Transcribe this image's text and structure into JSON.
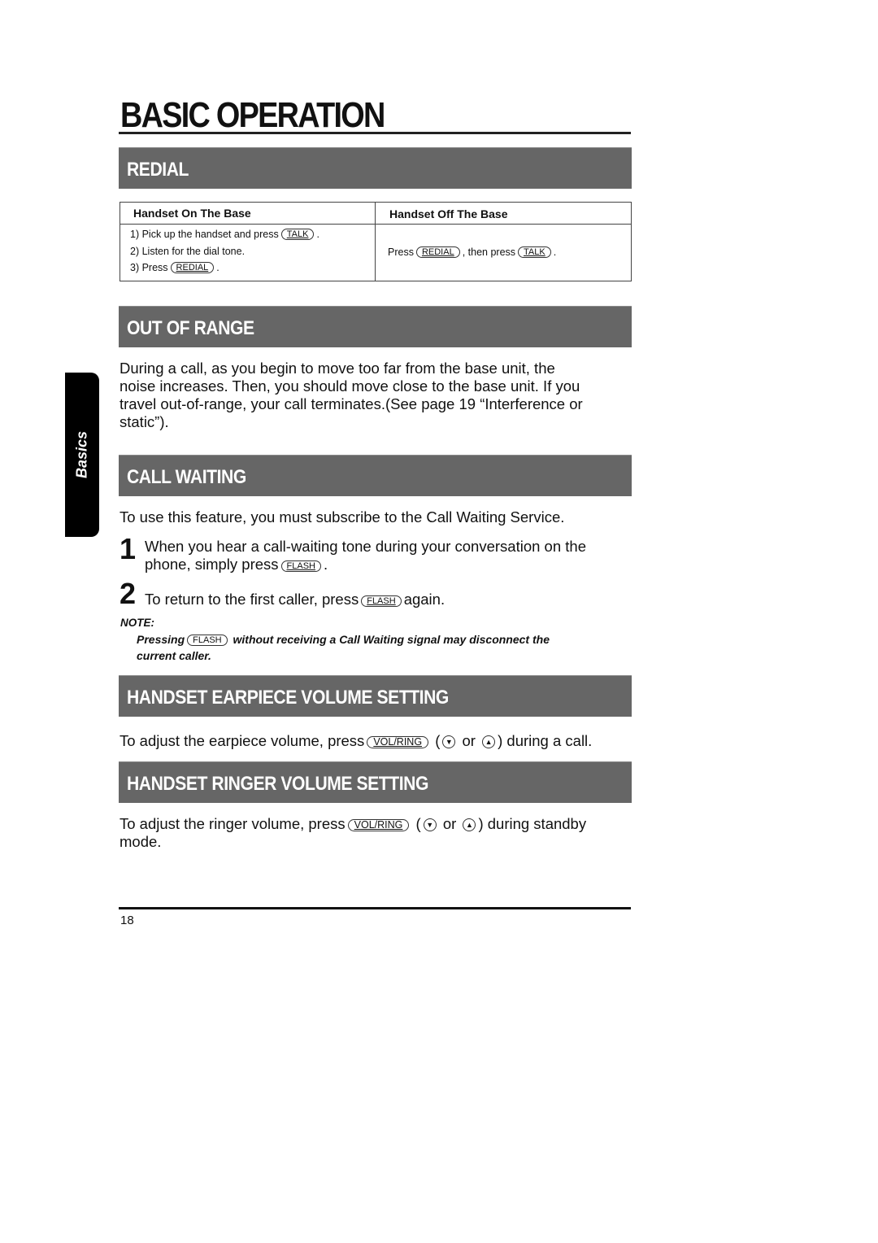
{
  "page": {
    "title": "BASIC OPERATION",
    "side_tab": "Basics",
    "page_number": "18"
  },
  "redial": {
    "heading": "REDIAL",
    "table": {
      "columns": [
        "Handset On The Base",
        "Handset Off The Base"
      ],
      "on_base_steps": [
        {
          "prefix": "1) Pick up the handset and press",
          "key": "TALK",
          "suffix": "."
        },
        {
          "prefix": "2) Listen for the dial tone.",
          "key": null,
          "suffix": ""
        },
        {
          "prefix": "3) Press",
          "key": "REDIAL",
          "suffix": "."
        }
      ],
      "off_base": {
        "prefix": "Press",
        "key1": "REDIAL",
        "middle": ", then press",
        "key2": "TALK",
        "suffix": "."
      }
    }
  },
  "out_of_range": {
    "heading": "OUT OF RANGE",
    "lines": [
      "During a call, as you begin to move too far from the base unit, the",
      "noise increases. Then, you should move close to the base unit. If you",
      "travel out-of-range, your call terminates.(See page 19 “Interference or",
      "static”)."
    ]
  },
  "call_waiting": {
    "heading": "CALL WAITING",
    "intro": "To use this feature, you must subscribe to the Call Waiting Service.",
    "steps": [
      {
        "number": "1",
        "line1": "When you hear a call-waiting tone during your conversation on the",
        "line2_prefix": "phone, simply press",
        "key": "FLASH",
        "suffix": "."
      },
      {
        "number": "2",
        "prefix": "To return to the first caller, press",
        "key": "FLASH",
        "suffix": "again."
      }
    ],
    "note": {
      "label": "NOTE:",
      "prefix": "Pressing",
      "key": "FLASH",
      "suffix": "without receiving a Call Waiting signal may disconnect the",
      "line2": "current caller."
    }
  },
  "earpiece_volume": {
    "heading": "HANDSET EARPIECE VOLUME SETTING",
    "prefix": "To adjust the earpiece volume, press",
    "key": "VOL/RING",
    "open": "(",
    "down_icon": "▼",
    "or": "or",
    "up_icon": "▲",
    "suffix": ") during a call."
  },
  "ringer_volume": {
    "heading": "HANDSET RINGER VOLUME SETTING",
    "prefix": "To adjust the ringer volume, press",
    "key": "VOL/RING",
    "open": "(",
    "down_icon": "▼",
    "or": "or",
    "up_icon": "▲",
    "suffix": ") during standby",
    "line2": "mode."
  },
  "colors": {
    "section_bar": "#666666",
    "text": "#111111",
    "side_tab": "#000000"
  }
}
